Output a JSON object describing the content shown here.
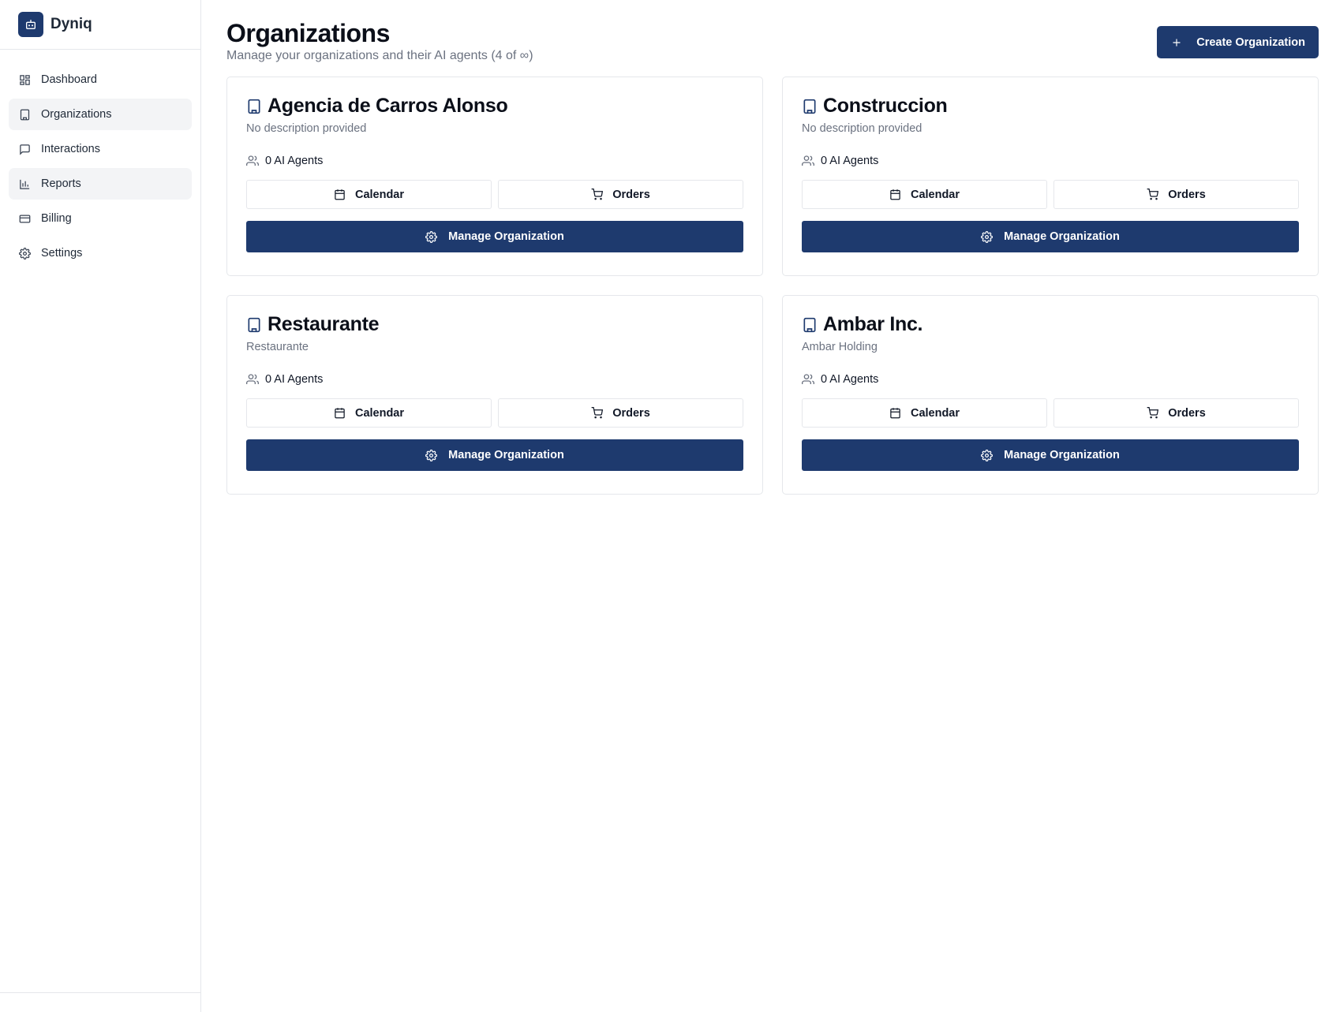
{
  "brand": {
    "name": "Dyniq",
    "logo_icon": "bot-icon",
    "accent_color": "#1e3a6e"
  },
  "sidebar": {
    "items": [
      {
        "label": "Dashboard",
        "icon": "dashboard-grid-icon"
      },
      {
        "label": "Organizations",
        "icon": "building-icon"
      },
      {
        "label": "Interactions",
        "icon": "message-square-icon"
      },
      {
        "label": "Reports",
        "icon": "bar-chart-icon"
      },
      {
        "label": "Billing",
        "icon": "credit-card-icon"
      },
      {
        "label": "Settings",
        "icon": "gear-icon"
      }
    ]
  },
  "header": {
    "title": "Organizations",
    "subtitle": "Manage your organizations and their AI agents (4 of ∞)",
    "create_button": "Create Organization"
  },
  "organizations": [
    {
      "name": "Agencia de Carros Alonso",
      "description": "No description provided",
      "agents": "0 AI Agents",
      "calendar": "Calendar",
      "orders": "Orders",
      "manage": "Manage Organization"
    },
    {
      "name": "Construccion",
      "description": "No description provided",
      "agents": "0 AI Agents",
      "calendar": "Calendar",
      "orders": "Orders",
      "manage": "Manage Organization"
    },
    {
      "name": "Restaurante",
      "description": "Restaurante",
      "agents": "0 AI Agents",
      "calendar": "Calendar",
      "orders": "Orders",
      "manage": "Manage Organization"
    },
    {
      "name": "Ambar Inc.",
      "description": "Ambar Holding",
      "agents": "0 AI Agents",
      "calendar": "Calendar",
      "orders": "Orders",
      "manage": "Manage Organization"
    }
  ]
}
